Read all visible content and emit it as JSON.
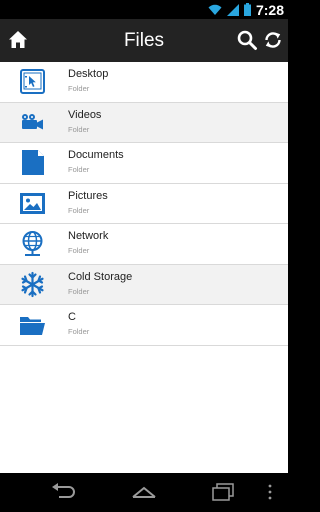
{
  "status_bar": {
    "time": "7:28"
  },
  "app_bar": {
    "title": "Files"
  },
  "items": [
    {
      "name": "Desktop",
      "type": "Folder",
      "icon": "desktop-icon"
    },
    {
      "name": "Videos",
      "type": "Folder",
      "icon": "video-camera-icon"
    },
    {
      "name": "Documents",
      "type": "Folder",
      "icon": "document-icon"
    },
    {
      "name": "Pictures",
      "type": "Folder",
      "icon": "picture-icon"
    },
    {
      "name": "Network",
      "type": "Folder",
      "icon": "network-globe-icon"
    },
    {
      "name": "Cold Storage",
      "type": "Folder",
      "icon": "snowflake-icon"
    },
    {
      "name": "C",
      "type": "Folder",
      "icon": "open-folder-icon"
    }
  ],
  "colors": {
    "accent": "#1a6fc2",
    "app_bar": "#232323",
    "row_alt": "#f2f2f2"
  }
}
